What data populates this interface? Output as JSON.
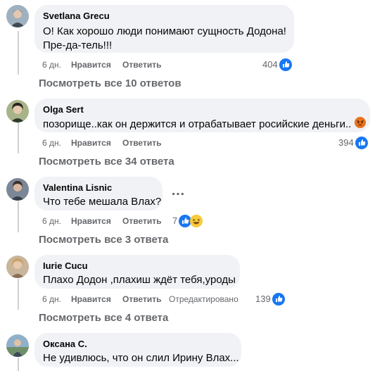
{
  "comments": [
    {
      "author": "Svetlana Grecu",
      "lines": [
        "О! Как хорошо люди понимают сущность Додона!",
        "Пре-да-тель!!!"
      ],
      "time": "6 дн.",
      "like": "Нравится",
      "reply": "Ответить",
      "edited": "",
      "reaction_count": "404",
      "reactions": [
        "like-icon"
      ],
      "replies_label": "Посмотреть все 10 ответов",
      "avatar_color": "#7a8a99"
    },
    {
      "author": "Olga Sert",
      "lines": [
        "позорище..как он держится и отрабатывает росийские деньги.."
      ],
      "emoji": "angry-emoji-icon",
      "time": "6 дн.",
      "like": "Нравится",
      "reply": "Ответить",
      "edited": "",
      "reaction_count": "394",
      "reactions": [
        "like-icon"
      ],
      "replies_label": "Посмотреть все 34 ответа",
      "avatar_color": "#8c9c6a"
    },
    {
      "author": "Valentina Lisnic",
      "lines": [
        "Что тебе мешала Влах?"
      ],
      "more": "…",
      "time": "6 дн.",
      "like": "Нравится",
      "reply": "Ответить",
      "edited": "",
      "reaction_count": "7",
      "reactions": [
        "like-icon",
        "laugh-icon"
      ],
      "replies_label": "Посмотреть все 3 ответа",
      "avatar_color": "#5f6b7a"
    },
    {
      "author": "Iurie Cucu",
      "lines": [
        "Плахо Додон ,плахиш ждёт тебя,уроды"
      ],
      "time": "6 дн.",
      "like": "Нравится",
      "reply": "Ответить",
      "edited": "Отредактировано",
      "reaction_count": "139",
      "reactions": [
        "like-icon"
      ],
      "replies_label": "Посмотреть все 4 ответа",
      "avatar_color": "#b89a7a"
    },
    {
      "author": "Оксана С.",
      "lines": [
        "Не удивлюсь, что он слил Ирину Влах..."
      ],
      "avatar_color": "#6f8f7a"
    }
  ],
  "colors": {
    "bubble": "#f0f2f5",
    "meta_text": "#65676b",
    "like_blue": "#1877f2",
    "thread_line": "#ced0d4"
  }
}
